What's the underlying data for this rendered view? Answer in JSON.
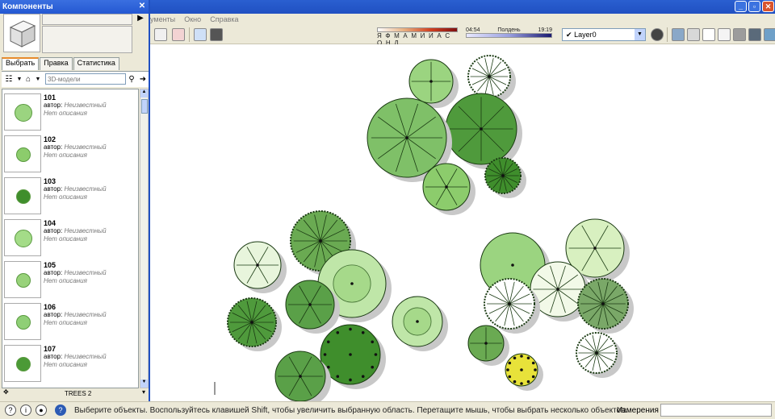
{
  "app_menu": {
    "items": [
      "ументы",
      "Окно",
      "Справка"
    ]
  },
  "panel": {
    "title": "Компоненты",
    "tabs": [
      {
        "label": "Выбрать"
      },
      {
        "label": "Правка"
      },
      {
        "label": "Статистика"
      }
    ],
    "search_placeholder": "3D-модели",
    "collection_label": "TREES 2",
    "items": [
      {
        "name": "101",
        "author_label": "автор:",
        "author": "Неизвестный",
        "description": "Нет описания",
        "color": "#9bd480",
        "size": "lg"
      },
      {
        "name": "102",
        "author_label": "автор:",
        "author": "Неизвестный",
        "description": "Нет описания",
        "color": "#8ccc6c",
        "size": "md"
      },
      {
        "name": "103",
        "author_label": "автор:",
        "author": "Неизвестный",
        "description": "Нет описания",
        "color": "#3f8e2c",
        "size": "md"
      },
      {
        "name": "104",
        "author_label": "автор:",
        "author": "Неизвестный",
        "description": "Нет описания",
        "color": "#a4dc88",
        "size": "lg"
      },
      {
        "name": "105",
        "author_label": "автор:",
        "author": "Неизвестный",
        "description": "Нет описания",
        "color": "#98d27a",
        "size": "md"
      },
      {
        "name": "106",
        "author_label": "автор:",
        "author": "Неизвестный",
        "description": "Нет описания",
        "color": "#8fcf76",
        "size": "md"
      },
      {
        "name": "107",
        "author_label": "автор:",
        "author": "Неизвестный",
        "description": "Нет описания",
        "color": "#4b9a36",
        "size": "md"
      }
    ]
  },
  "toolbar": {
    "shadow_months": "Я Ф М А М И И А С О Н Д",
    "time_start": "04:54",
    "time_noon": "Полдень",
    "time_end": "19:19",
    "layer_name": "Layer0"
  },
  "status_bar": {
    "message": "Выберите объекты. Воспользуйтесь клавишей Shift, чтобы увеличить выбранную область. Перетащите мышь, чтобы выбрать несколько объектов.",
    "measurements_label": "Измерения"
  },
  "colors": {
    "accent": "#2050c2",
    "tree_dark": "#3f8e2c",
    "tree_light": "#bfe6a8",
    "tree_yellow": "#e8e23a"
  }
}
